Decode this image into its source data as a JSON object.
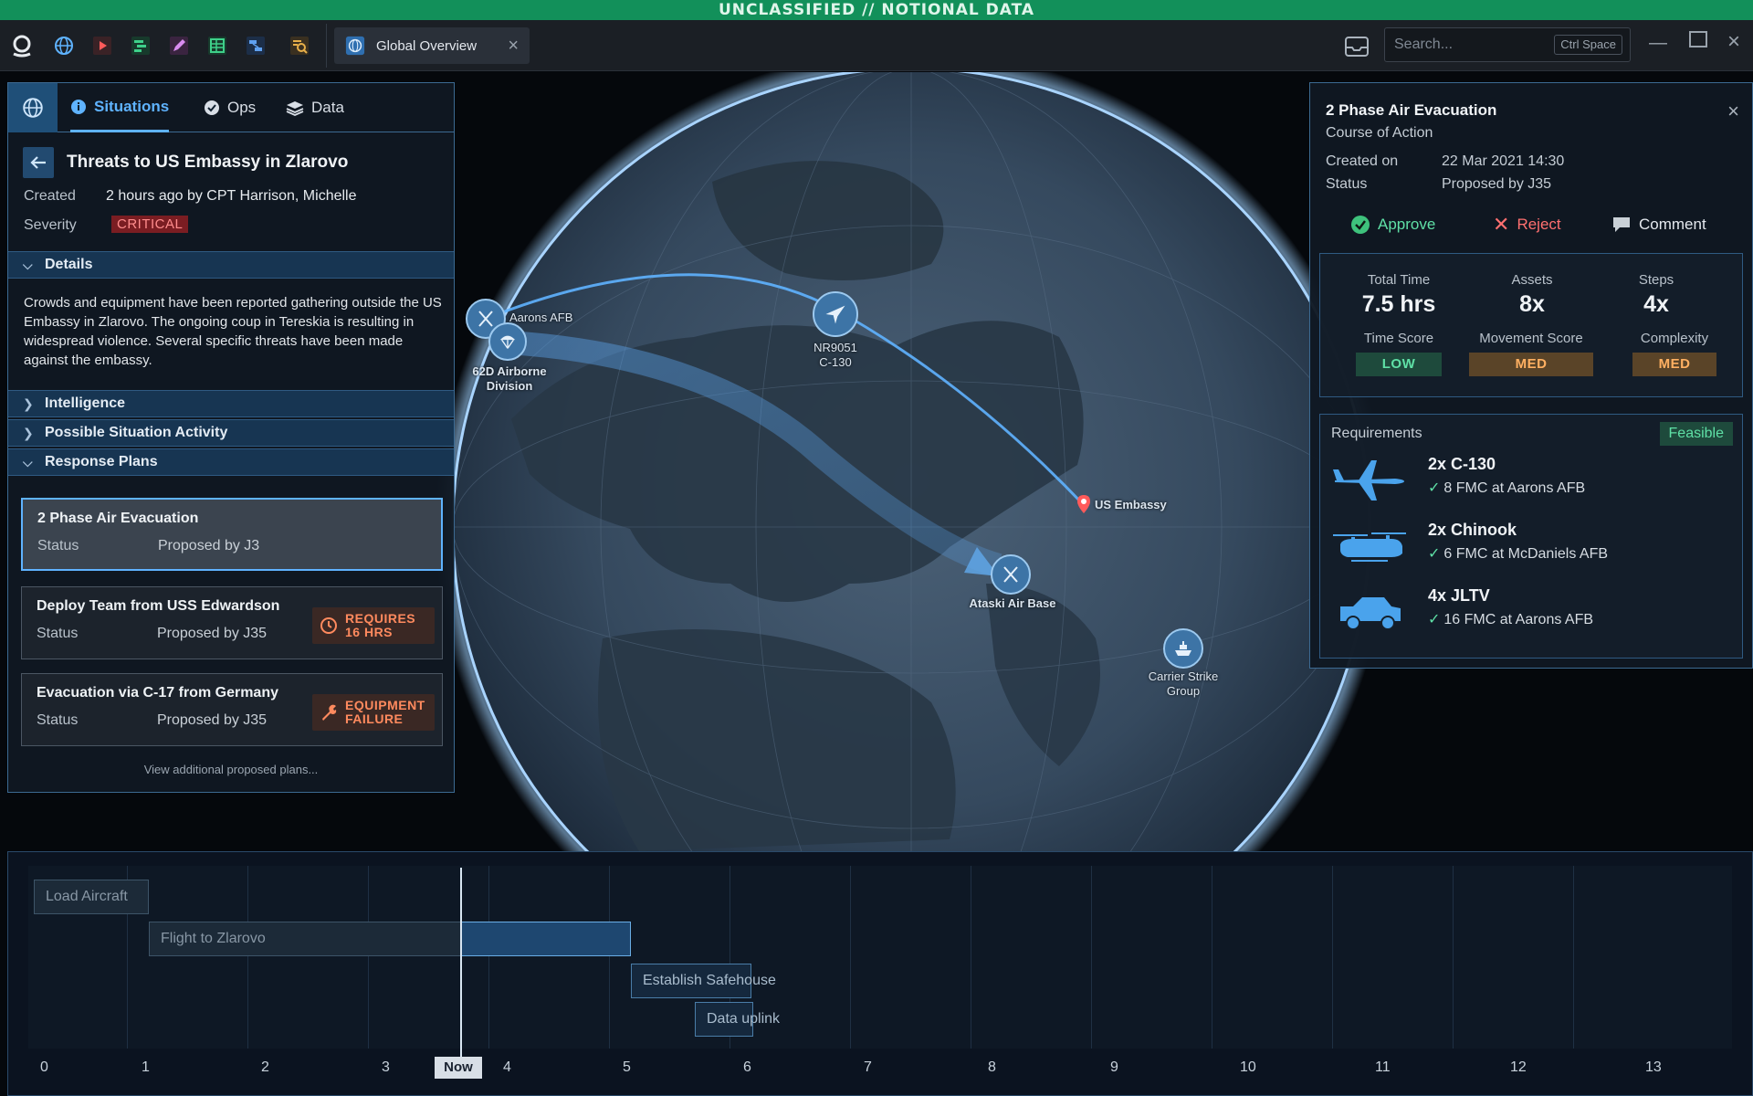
{
  "banner": "UNCLASSIFIED // NOTIONAL DATA",
  "topbar": {
    "icons": [
      "app-logo-icon",
      "globe-icon",
      "play-icon",
      "gantt-icon",
      "edit-icon",
      "table-icon",
      "flow-icon",
      "search-doc-icon"
    ],
    "tab_label": "Global Overview",
    "search_placeholder": "Search...",
    "search_shortcut": "Ctrl Space"
  },
  "left_panel": {
    "tabs": [
      {
        "label": "Situations",
        "icon": "info-icon",
        "active": true
      },
      {
        "label": "Ops",
        "icon": "check-circle-icon",
        "active": false
      },
      {
        "label": "Data",
        "icon": "layers-icon",
        "active": false
      }
    ],
    "title": "Threats to US Embassy in Zlarovo",
    "created_label": "Created",
    "created_value": "2 hours ago by CPT Harrison, Michelle",
    "severity_label": "Severity",
    "severity_value": "CRITICAL",
    "sections": {
      "details": "Details",
      "intelligence": "Intelligence",
      "activity": "Possible Situation Activity",
      "response": "Response Plans"
    },
    "details_text": "Crowds and equipment have been reported gathering outside the US Embassy in Zlarovo. The ongoing coup in Tereskia is resulting in widespread violence. Several specific threats have been made against the embassy.",
    "plans": [
      {
        "title": "2 Phase Air Evacuation",
        "status_label": "Status",
        "status": "Proposed by J3"
      },
      {
        "title": "Deploy Team from USS Edwardson",
        "status_label": "Status",
        "status": "Proposed by J35",
        "badge_line1": "REQUIRES",
        "badge_line2": "16 HRS"
      },
      {
        "title": "Evacuation via C-17 from Germany",
        "status_label": "Status",
        "status": "Proposed by J35",
        "badge_line1": "EQUIPMENT",
        "badge_line2": "FAILURE"
      }
    ],
    "view_more": "View additional proposed plans..."
  },
  "map": {
    "labels": {
      "aarons": "Aarons AFB",
      "airborne_1": "62D Airborne",
      "airborne_2": "Division",
      "aircraft_1": "NR9051",
      "aircraft_2": "C-130",
      "embassy": "US Embassy",
      "ataski": "Ataski Air Base",
      "carrier_1": "Carrier Strike",
      "carrier_2": "Group"
    }
  },
  "right_panel": {
    "title": "2 Phase Air Evacuation",
    "subtitle": "Course of Action",
    "created_label": "Created on",
    "created_value": "22 Mar 2021  14:30",
    "status_label": "Status",
    "status_value": "Proposed by J35",
    "actions": {
      "approve": "Approve",
      "reject": "Reject",
      "comment": "Comment"
    },
    "stats": [
      {
        "label": "Total Time",
        "value": "7.5 hrs"
      },
      {
        "label": "Assets",
        "value": "8x"
      },
      {
        "label": "Steps",
        "value": "4x"
      }
    ],
    "scores": [
      {
        "label": "Time Score",
        "value": "LOW"
      },
      {
        "label": "Movement Score",
        "value": "MED"
      },
      {
        "label": "Complexity",
        "value": "MED"
      }
    ],
    "requirements_title": "Requirements",
    "feasible": "Feasible",
    "requirements": [
      {
        "name": "2x C-130",
        "detail": "8 FMC at Aarons AFB",
        "icon": "c130-aircraft-icon"
      },
      {
        "name": "2x Chinook",
        "detail": "6 FMC at McDaniels AFB",
        "icon": "chinook-helicopter-icon"
      },
      {
        "name": "4x JLTV",
        "detail": "16 FMC at Aarons AFB",
        "icon": "jltv-vehicle-icon"
      }
    ]
  },
  "timeline": {
    "tasks": [
      "Load Aircraft",
      "Flight to Zlarovo",
      "Establish Safehouse",
      "Data uplink"
    ],
    "ticks": [
      "0",
      "1",
      "2",
      "3",
      "4",
      "5",
      "6",
      "7",
      "8",
      "9",
      "10",
      "11",
      "12",
      "13"
    ],
    "now_label": "Now"
  },
  "colors": {
    "accent": "#5fb3ff",
    "critical": "#ff8c8c",
    "feasible": "#5fe0a6",
    "warning": "#ff8a5e",
    "banner": "#12905a"
  }
}
